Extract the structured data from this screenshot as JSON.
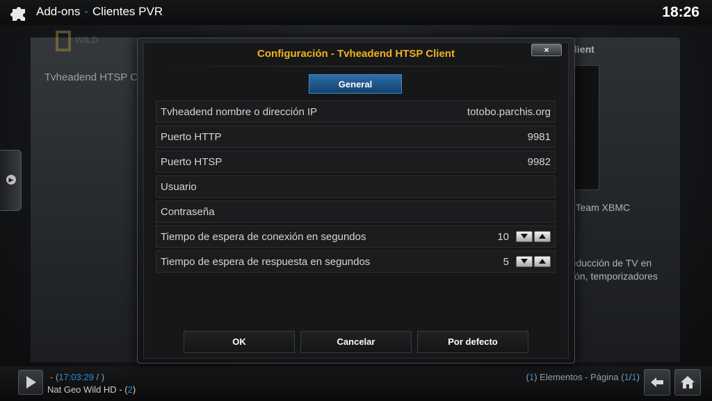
{
  "header": {
    "section": "Add-ons",
    "separator": "-",
    "subsection": "Clientes PVR",
    "clock": "18:26"
  },
  "background": {
    "list_item": "Tvheadend HTSP C",
    "right_title": "lient",
    "author": ", Team XBMC",
    "description_line1": "roducción de TV en",
    "description_line2": "ción, temporizadores",
    "logo_text": "WILD"
  },
  "dialog": {
    "title": "Configuración - Tvheadend HTSP Client",
    "close_label": "×",
    "category": "General",
    "settings": [
      {
        "label": "Tvheadend nombre o dirección IP",
        "value": "totobo.parchis.org"
      },
      {
        "label": "Puerto HTTP",
        "value": "9981"
      },
      {
        "label": "Puerto HTSP",
        "value": "9982"
      },
      {
        "label": "Usuario",
        "value": ""
      },
      {
        "label": "Contraseña",
        "value": ""
      },
      {
        "label": "Tiempo de espera de conexión en segundos",
        "value": "10"
      },
      {
        "label": "Tiempo de espera de respuesta en segundos",
        "value": "5"
      }
    ],
    "buttons": {
      "ok": "OK",
      "cancel": "Cancelar",
      "default": "Por defecto"
    }
  },
  "footer": {
    "time_prefix": "- (",
    "time": "17:03:29",
    "time_suffix": " / )",
    "channel": "Nat Geo Wild HD",
    "channel_sep": " - (",
    "channel_num": "2",
    "channel_end": ")",
    "items_open": "(",
    "items_count": "1",
    "items_text": ") Elementos - Página (",
    "page_current": "1",
    "page_sep": "/",
    "page_total": "1",
    "page_close": ")"
  },
  "colors": {
    "accent_blue": "#2e8fd8",
    "title_orange": "#f0b31c",
    "category_blue": "#1f5a8f"
  }
}
